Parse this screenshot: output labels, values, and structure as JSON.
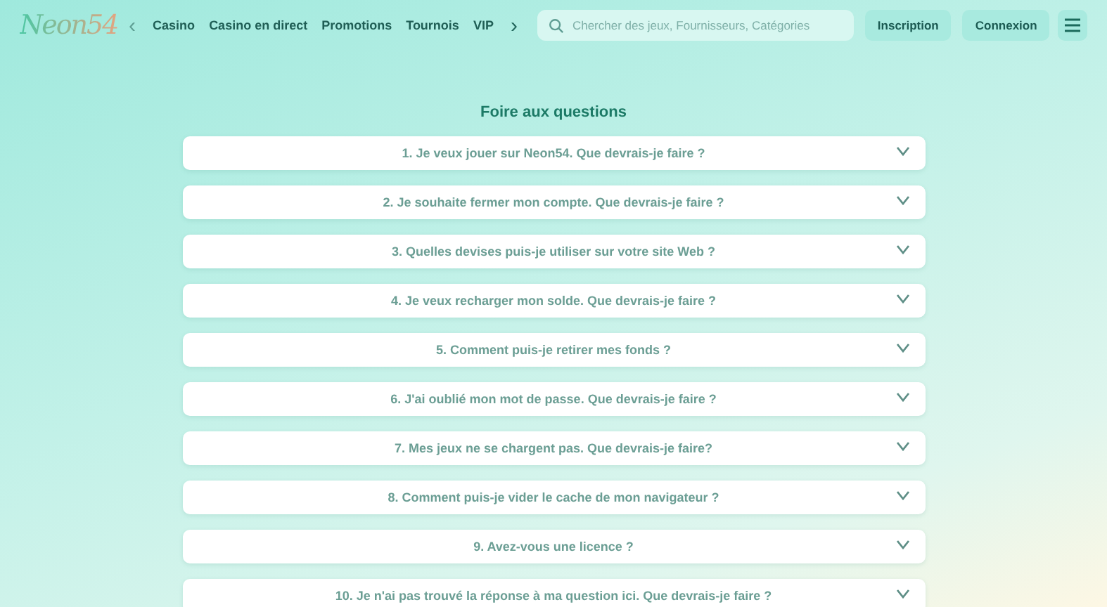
{
  "header": {
    "logo": "Neon54",
    "nav_prev": "‹",
    "nav": [
      "Casino",
      "Casino en direct",
      "Promotions",
      "Tournois",
      "VIP"
    ],
    "nav_next": "›",
    "search": {
      "placeholder": "Chercher des jeux, Fournisseurs, Catégories"
    },
    "buttons": [
      "Inscription",
      "Connexion"
    ]
  },
  "faq": {
    "title": "Foire aux questions",
    "items": [
      {
        "question": "1. Je veux jouer sur Neon54. Que devrais-je faire ?",
        "expanded": false
      },
      {
        "question": "2. Je souhaite fermer mon compte. Que devrais-je faire ?",
        "expanded": false
      },
      {
        "question": "3. Quelles devises puis-je utiliser sur votre site Web ?",
        "expanded": false
      },
      {
        "question": "4. Je veux recharger mon solde. Que devrais-je faire ?",
        "expanded": false
      },
      {
        "question": "5. Comment puis-je retirer mes fonds ?",
        "expanded": false
      },
      {
        "question": "6. J'ai oublié mon mot de passe. Que devrais-je faire ?",
        "expanded": false
      },
      {
        "question": "7. Mes jeux ne se chargent pas. Que devrais-je faire?",
        "expanded": false
      },
      {
        "question": "8. Comment puis-je vider le cache de mon navigateur ?",
        "expanded": false
      },
      {
        "question": "9. Avez-vous une licence ?",
        "expanded": false
      },
      {
        "question": "10. Je n'ai pas trouvé la réponse à ma question ici. Que devrais-je faire ?",
        "expanded": false
      }
    ]
  }
}
